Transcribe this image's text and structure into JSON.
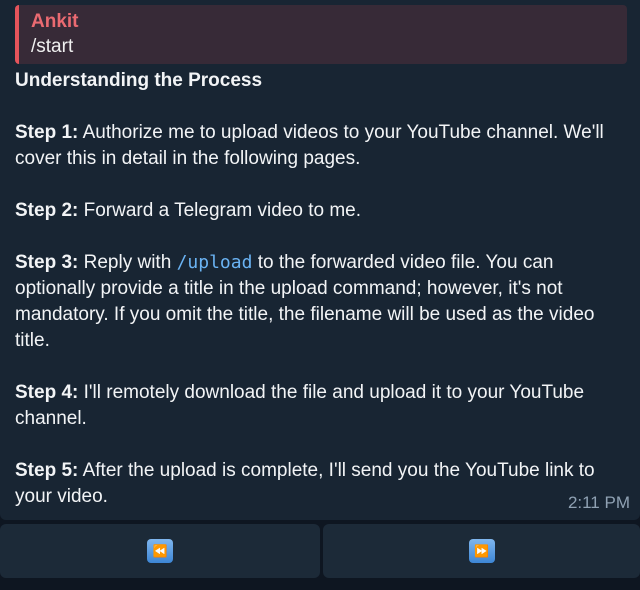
{
  "reply": {
    "author": "Ankit",
    "text": "/start"
  },
  "message": {
    "heading": "Understanding the Process",
    "steps": [
      {
        "label": "Step 1:",
        "text": " Authorize me to upload videos to your YouTube channel. We'll cover this in detail in the following pages."
      },
      {
        "label": "Step 2:",
        "text": " Forward a Telegram video to me."
      },
      {
        "label": "Step 3:",
        "text_before": " Reply with ",
        "command": "/upload",
        "text_after": " to the forwarded video file. You can optionally provide a title in the upload command; however, it's not mandatory. If you omit the title, the filename will be used as the video title."
      },
      {
        "label": "Step 4:",
        "text": " I'll remotely download the file and upload it to your YouTube channel."
      },
      {
        "label": "Step 5:",
        "text": " After the upload is complete, I'll send you the YouTube link to your video."
      }
    ],
    "time": "2:11 PM"
  },
  "keyboard": {
    "buttons": [
      {
        "label": "⏪",
        "icon": "rewind-icon"
      },
      {
        "label": "⏩",
        "icon": "fast-forward-icon"
      }
    ]
  },
  "colors": {
    "background": "#0e1621",
    "bubble": "#182533",
    "reply_background": "#372a37",
    "reply_accent": "#e5545b",
    "command": "#6ab3f3",
    "button": "#1c2a38"
  }
}
